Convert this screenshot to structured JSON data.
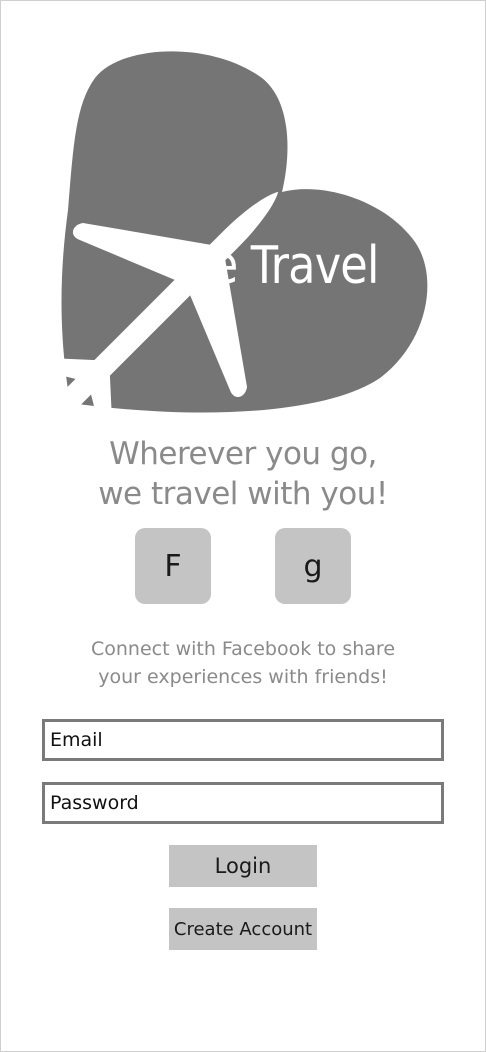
{
  "brand": {
    "name": "We Travel"
  },
  "tagline": {
    "line1": "Wherever you go,",
    "line2": "we travel with you!"
  },
  "social": {
    "facebook_label": "F",
    "google_label": "g"
  },
  "connect": {
    "line1": "Connect with Facebook to share",
    "line2": "your experiences with friends!"
  },
  "form": {
    "email_placeholder": "Email",
    "email_value": "",
    "password_placeholder": "Password",
    "password_value": ""
  },
  "actions": {
    "login_label": "Login",
    "create_account_label": "Create Account"
  },
  "colors": {
    "heart": "#757575",
    "airplane": "#ffffff",
    "button_bg": "#c4c4c4",
    "muted_text": "#8a8a8a",
    "field_border": "#7a7a7a"
  },
  "icons": {
    "logo_heart": "heart-icon",
    "logo_plane": "airplane-icon"
  }
}
